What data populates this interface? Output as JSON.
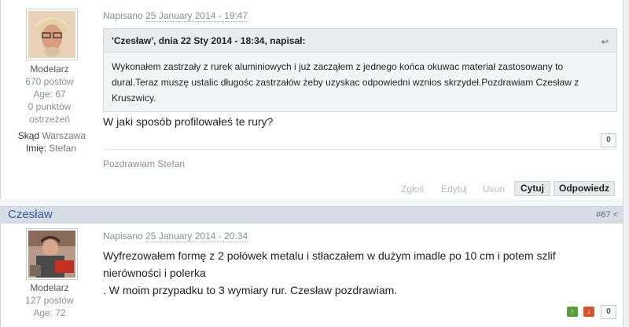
{
  "post1": {
    "user": {
      "role": "Modelarz",
      "posts": "670 postów",
      "age": "Age: 67",
      "warnings_line1": "0 punktów",
      "warnings_line2": "ostrzeżeń",
      "from_label": "Skąd",
      "from_value": "Warszawa",
      "name_label": "Imię:",
      "name_value": "Stefan",
      "avatar_icon": "avatar-elderly-man-photo"
    },
    "date_prefix": "Napisano",
    "date": "25 January 2014 - 19:47",
    "quote": {
      "header": "'Czesław', dnia 22 Sty 2014 - 18:34, napisał:",
      "body": "Wykonałem zastrzały z rurek aluminiowych i już zacząłem z jednego końca okuwac materiał zastosowany to dural.Teraz muszę ustalic długośc zastrzałów żeby uzyskac odpowiedni wznios skrzydeł.Pozdrawiam Czesław z Kruszwicy."
    },
    "text": "W jaki sposób profilowałeś te rury?",
    "reputation": "0",
    "signature": "Pozdrawiam Stefan",
    "actions": {
      "delete": "Zgłoś",
      "edit": "Edytuj",
      "remove": "Usuń",
      "quote": "Cytuj",
      "reply": "Odpowiedz"
    }
  },
  "post2": {
    "author": "Czesław",
    "number": "#67",
    "user": {
      "role": "Modelarz",
      "posts": "127 postów",
      "age": "Age: 72",
      "avatar_icon": "avatar-man-photo"
    },
    "date_prefix": "Napisano",
    "date": "25 January 2014 - 20:34",
    "text_line1": "Wyfrezowałem formę z 2 połówek metalu i stłaczałem w dużym imadle po 10 cm i potem szlif",
    "text_line2": "nierówności i polerka",
    "text_line3": ". W moim przypadku to 3 wymiary rur. Czesław pozdrawiam.",
    "reputation": "0"
  },
  "colors": {
    "author_link": "#2b5d9c",
    "vote_up": "#5a9e3a",
    "vote_down": "#d9532c"
  }
}
